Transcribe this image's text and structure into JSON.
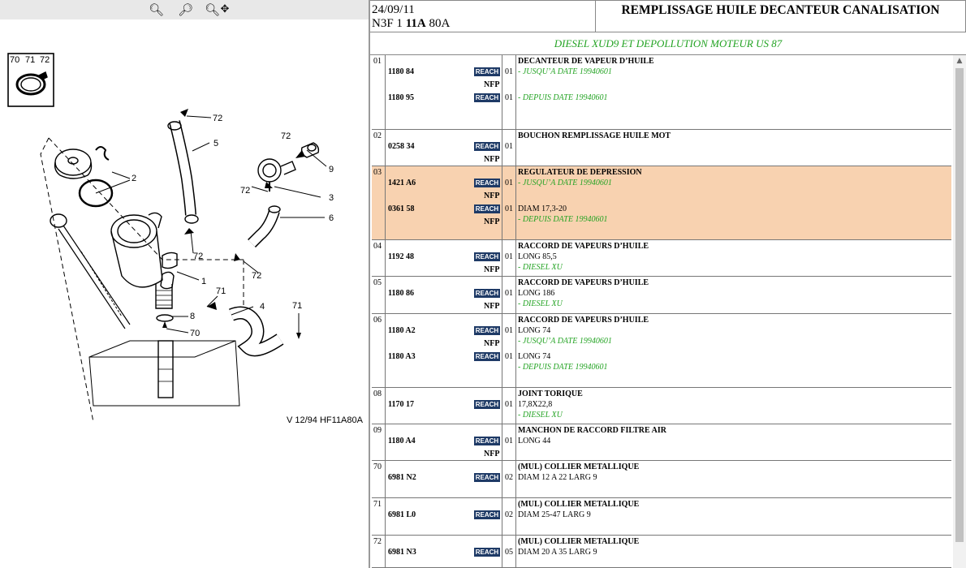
{
  "toolbar": {
    "zoom_in_icon": "zoom-in-icon",
    "zoom_out_icon": "zoom-out-icon",
    "pan_icon": "zoom-pan-icon"
  },
  "diagram": {
    "labels": [
      "70",
      "71",
      "72",
      "72",
      "5",
      "2",
      "72",
      "9",
      "72",
      "3",
      "6",
      "72",
      "72",
      "1",
      "71",
      "4",
      "71",
      "8",
      "70"
    ],
    "caption": "V 12/94  HF11A80A"
  },
  "header": {
    "date": "24/09/11",
    "code_prefix": "N3F 1 ",
    "code_bold": "11A",
    "code_suffix": " 80A",
    "title": "REMPLISSAGE HUILE DECANTEUR CANALISATION"
  },
  "subtitle": "DIESEL XUD9 ET DEPOLLUTION MOTEUR US 87",
  "reach_label": "REACH",
  "nfp_label": "NFP",
  "rows": [
    {
      "num": "01",
      "entries": [
        {
          "ref": "1180 84",
          "qty": "01",
          "nfp": true,
          "lines": [
            {
              "text": "DECANTEUR DE VAPEUR D’HUILE",
              "style": "title"
            },
            {
              "text": "- JUSQU’A DATE 19940601",
              "style": "green"
            }
          ]
        },
        {
          "ref": "1180 95",
          "qty": "01",
          "nfp": false,
          "lines": [
            {
              "text": "- DEPUIS DATE 19940601",
              "style": "green"
            }
          ]
        }
      ]
    },
    {
      "num": "02",
      "entries": [
        {
          "ref": "0258 34",
          "qty": "01",
          "nfp": true,
          "lines": [
            {
              "text": "BOUCHON REMPLISSAGE HUILE MOT",
              "style": "title"
            }
          ]
        }
      ]
    },
    {
      "num": "03",
      "highlight": true,
      "entries": [
        {
          "ref": "1421 A6",
          "qty": "01",
          "nfp": true,
          "lines": [
            {
              "text": "REGULATEUR DE DEPRESSION",
              "style": "title"
            },
            {
              "text": "- JUSQU’A DATE 19940601",
              "style": "green"
            }
          ]
        },
        {
          "ref": "0361 58",
          "qty": "01",
          "nfp": true,
          "lines": [
            {
              "text": "DIAM 17,3-20",
              "style": "normal"
            },
            {
              "text": "- DEPUIS DATE 19940601",
              "style": "green"
            }
          ]
        }
      ]
    },
    {
      "num": "04",
      "entries": [
        {
          "ref": "1192 48",
          "qty": "01",
          "nfp": true,
          "lines": [
            {
              "text": "RACCORD DE VAPEURS D’HUILE",
              "style": "title"
            },
            {
              "text": "LONG 85,5",
              "style": "normal"
            },
            {
              "text": "- DIESEL XU",
              "style": "green"
            }
          ]
        }
      ]
    },
    {
      "num": "05",
      "entries": [
        {
          "ref": "1180 86",
          "qty": "01",
          "nfp": true,
          "lines": [
            {
              "text": "RACCORD DE VAPEURS D’HUILE",
              "style": "title"
            },
            {
              "text": "LONG 186",
              "style": "normal"
            },
            {
              "text": "- DIESEL XU",
              "style": "green"
            }
          ]
        }
      ]
    },
    {
      "num": "06",
      "entries": [
        {
          "ref": "1180 A2",
          "qty": "01",
          "nfp": true,
          "lines": [
            {
              "text": "RACCORD DE VAPEURS D’HUILE",
              "style": "title"
            },
            {
              "text": "LONG 74",
              "style": "normal"
            },
            {
              "text": "- JUSQU’A DATE 19940601",
              "style": "green"
            }
          ]
        },
        {
          "ref": "1180 A3",
          "qty": "01",
          "nfp": false,
          "lines": [
            {
              "text": "LONG 74",
              "style": "normal"
            },
            {
              "text": "- DEPUIS DATE 19940601",
              "style": "green"
            }
          ]
        }
      ]
    },
    {
      "num": "08",
      "entries": [
        {
          "ref": "1170 17",
          "qty": "01",
          "nfp": false,
          "lines": [
            {
              "text": "JOINT TORIQUE",
              "style": "title"
            },
            {
              "text": "17,8X22,8",
              "style": "normal"
            },
            {
              "text": "- DIESEL XU",
              "style": "green"
            }
          ]
        }
      ]
    },
    {
      "num": "09",
      "entries": [
        {
          "ref": "1180 A4",
          "qty": "01",
          "nfp": true,
          "lines": [
            {
              "text": "MANCHON DE RACCORD FILTRE AIR",
              "style": "title"
            },
            {
              "text": "LONG 44",
              "style": "normal"
            }
          ]
        }
      ]
    },
    {
      "num": "70",
      "entries": [
        {
          "ref": "6981 N2",
          "qty": "02",
          "nfp": false,
          "lines": [
            {
              "text": "(MUL) COLLIER METALLIQUE",
              "style": "title"
            },
            {
              "text": "DIAM 12 A 22 LARG 9",
              "style": "normal"
            }
          ]
        }
      ]
    },
    {
      "num": "71",
      "entries": [
        {
          "ref": "6981 L0",
          "qty": "02",
          "nfp": false,
          "lines": [
            {
              "text": "(MUL) COLLIER METALLIQUE",
              "style": "title"
            },
            {
              "text": "DIAM 25-47 LARG 9",
              "style": "normal"
            }
          ]
        }
      ]
    },
    {
      "num": "72",
      "entries": [
        {
          "ref": "6981 N3",
          "qty": "05",
          "nfp": false,
          "lines": [
            {
              "text": "(MUL) COLLIER METALLIQUE",
              "style": "title"
            },
            {
              "text": "DIAM 20 A 35 LARG 9",
              "style": "normal"
            }
          ]
        }
      ]
    }
  ]
}
